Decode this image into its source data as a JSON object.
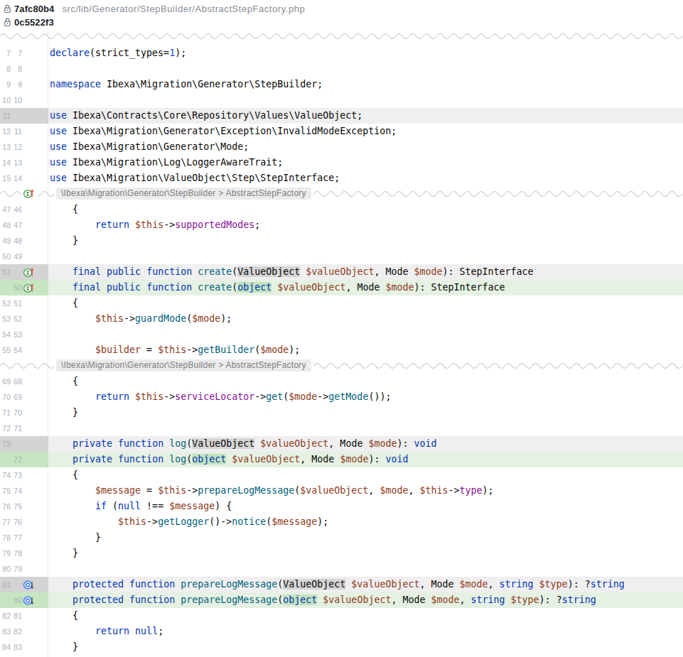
{
  "header": {
    "old_commit": "7afc80b4",
    "new_commit": "0c5522f3",
    "file_path": "src/lib/Generator/StepBuilder/AbstractStepFactory.php"
  },
  "colors": {
    "keyword": "#0033b3",
    "function": "#00627a",
    "variable": "#8d3b20",
    "field": "#871094",
    "number": "#1750eb",
    "plain_text": "#080808",
    "deleted_row_bg": "#efefef",
    "deleted_gutter_bg": "#d3d3d3",
    "deleted_word_bg": "#d5d5d5",
    "inserted_row_bg": "#e5f1e2",
    "inserted_gutter_bg": "#c5e6c0",
    "inserted_word_bg": "#c3e4be",
    "line_number": "#a9b0ba"
  },
  "icons": {
    "impl": "implements-method-icon",
    "ovr": "overridden-method-icon",
    "lock": "lock-icon"
  },
  "rows": [
    {
      "t": "wave"
    },
    {
      "t": "line",
      "k": "ctx",
      "o": "7",
      "n": "7",
      "icon": null,
      "seg": [
        [
          "kw",
          "declare"
        ],
        [
          "pl",
          "(strict_types="
        ],
        [
          "nm",
          "1"
        ],
        [
          "pl",
          ");"
        ]
      ]
    },
    {
      "t": "line",
      "k": "ctx",
      "o": "8",
      "n": "8",
      "icon": null,
      "seg": []
    },
    {
      "t": "line",
      "k": "ctx",
      "o": "9",
      "n": "9",
      "icon": null,
      "seg": [
        [
          "kw",
          "namespace"
        ],
        [
          "pl",
          " Ibexa\\Migration\\Generator\\StepBuilder;"
        ]
      ]
    },
    {
      "t": "line",
      "k": "ctx",
      "o": "10",
      "n": "10",
      "icon": null,
      "seg": []
    },
    {
      "t": "line",
      "k": "del",
      "o": "11",
      "n": null,
      "icon": null,
      "seg": [
        [
          "kw",
          "use"
        ],
        [
          "pl",
          " Ibexa\\Contracts\\Core\\Repository\\Values\\ValueObject;"
        ]
      ]
    },
    {
      "t": "line",
      "k": "ctx",
      "o": "12",
      "n": "11",
      "icon": null,
      "seg": [
        [
          "kw",
          "use"
        ],
        [
          "pl",
          " Ibexa\\Migration\\Generator\\Exception\\InvalidModeException;"
        ]
      ]
    },
    {
      "t": "line",
      "k": "ctx",
      "o": "13",
      "n": "12",
      "icon": null,
      "seg": [
        [
          "kw",
          "use"
        ],
        [
          "pl",
          " Ibexa\\Migration\\Generator\\Mode;"
        ]
      ]
    },
    {
      "t": "line",
      "k": "ctx",
      "o": "14",
      "n": "13",
      "icon": null,
      "seg": [
        [
          "kw",
          "use"
        ],
        [
          "pl",
          " Ibexa\\Migration\\Log\\LoggerAwareTrait;"
        ]
      ]
    },
    {
      "t": "line",
      "k": "ctx",
      "o": "15",
      "n": "14",
      "icon": null,
      "seg": [
        [
          "kw",
          "use"
        ],
        [
          "pl",
          " Ibexa\\Migration\\ValueObject\\Step\\StepInterface;"
        ]
      ]
    },
    {
      "t": "sep",
      "icon": "impl",
      "label": "\\Ibexa\\Migration\\Generator\\StepBuilder > AbstractStepFactory"
    },
    {
      "t": "line",
      "k": "ctx",
      "o": "47",
      "n": "46",
      "icon": null,
      "seg": [
        [
          "pl",
          "    {"
        ]
      ]
    },
    {
      "t": "line",
      "k": "ctx",
      "o": "48",
      "n": "47",
      "icon": null,
      "seg": [
        [
          "pl",
          "        "
        ],
        [
          "kw",
          "return"
        ],
        [
          "pl",
          " "
        ],
        [
          "vr",
          "$this"
        ],
        [
          "pl",
          "->"
        ],
        [
          "fd",
          "supportedModes"
        ],
        [
          "pl",
          ";"
        ]
      ]
    },
    {
      "t": "line",
      "k": "ctx",
      "o": "49",
      "n": "48",
      "icon": null,
      "seg": [
        [
          "pl",
          "    }"
        ]
      ]
    },
    {
      "t": "line",
      "k": "ctx",
      "o": "50",
      "n": "49",
      "icon": null,
      "seg": []
    },
    {
      "t": "line",
      "k": "del",
      "o": "51",
      "n": null,
      "icon": "impl",
      "seg": [
        [
          "pl",
          "    "
        ],
        [
          "kw",
          "final"
        ],
        [
          "pl",
          " "
        ],
        [
          "kw",
          "public"
        ],
        [
          "pl",
          " "
        ],
        [
          "kw",
          "function"
        ],
        [
          "pl",
          " "
        ],
        [
          "fn",
          "create"
        ],
        [
          "pl",
          "("
        ],
        [
          "pl",
          "ValueObject",
          1
        ],
        [
          "pl",
          " "
        ],
        [
          "vr",
          "$valueObject"
        ],
        [
          "pl",
          ", Mode "
        ],
        [
          "vr",
          "$mode"
        ],
        [
          "pl",
          "): StepInterface"
        ]
      ]
    },
    {
      "t": "line",
      "k": "ins",
      "o": null,
      "n": "50",
      "icon": "impl",
      "seg": [
        [
          "pl",
          "    "
        ],
        [
          "kw",
          "final"
        ],
        [
          "pl",
          " "
        ],
        [
          "kw",
          "public"
        ],
        [
          "pl",
          " "
        ],
        [
          "kw",
          "function"
        ],
        [
          "pl",
          " "
        ],
        [
          "fn",
          "create"
        ],
        [
          "pl",
          "("
        ],
        [
          "kw",
          "object",
          1
        ],
        [
          "pl",
          " "
        ],
        [
          "vr",
          "$valueObject"
        ],
        [
          "pl",
          ", Mode "
        ],
        [
          "vr",
          "$mode"
        ],
        [
          "pl",
          "): StepInterface"
        ]
      ]
    },
    {
      "t": "line",
      "k": "ctx",
      "o": "52",
      "n": "51",
      "icon": null,
      "seg": [
        [
          "pl",
          "    {"
        ]
      ]
    },
    {
      "t": "line",
      "k": "ctx",
      "o": "53",
      "n": "52",
      "icon": null,
      "seg": [
        [
          "pl",
          "        "
        ],
        [
          "vr",
          "$this"
        ],
        [
          "pl",
          "->"
        ],
        [
          "fn",
          "guardMode"
        ],
        [
          "pl",
          "("
        ],
        [
          "vr",
          "$mode"
        ],
        [
          "pl",
          ");"
        ]
      ]
    },
    {
      "t": "line",
      "k": "ctx",
      "o": "54",
      "n": "53",
      "icon": null,
      "seg": []
    },
    {
      "t": "line",
      "k": "ctx",
      "o": "55",
      "n": "54",
      "icon": null,
      "seg": [
        [
          "pl",
          "        "
        ],
        [
          "vr",
          "$builder"
        ],
        [
          "pl",
          " = "
        ],
        [
          "vr",
          "$this"
        ],
        [
          "pl",
          "->"
        ],
        [
          "fn",
          "getBuilder"
        ],
        [
          "pl",
          "("
        ],
        [
          "vr",
          "$mode"
        ],
        [
          "pl",
          ");"
        ]
      ]
    },
    {
      "t": "sep",
      "icon": null,
      "label": "\\Ibexa\\Migration\\Generator\\StepBuilder > AbstractStepFactory"
    },
    {
      "t": "line",
      "k": "ctx",
      "o": "69",
      "n": "68",
      "icon": null,
      "seg": [
        [
          "pl",
          "    {"
        ]
      ]
    },
    {
      "t": "line",
      "k": "ctx",
      "o": "70",
      "n": "69",
      "icon": null,
      "seg": [
        [
          "pl",
          "        "
        ],
        [
          "kw",
          "return"
        ],
        [
          "pl",
          " "
        ],
        [
          "vr",
          "$this"
        ],
        [
          "pl",
          "->"
        ],
        [
          "fd",
          "serviceLocator"
        ],
        [
          "pl",
          "->"
        ],
        [
          "fn",
          "get"
        ],
        [
          "pl",
          "("
        ],
        [
          "vr",
          "$mode"
        ],
        [
          "pl",
          "->"
        ],
        [
          "fn",
          "getMode"
        ],
        [
          "pl",
          "());"
        ]
      ]
    },
    {
      "t": "line",
      "k": "ctx",
      "o": "71",
      "n": "70",
      "icon": null,
      "seg": [
        [
          "pl",
          "    }"
        ]
      ]
    },
    {
      "t": "line",
      "k": "ctx",
      "o": "72",
      "n": "71",
      "icon": null,
      "seg": []
    },
    {
      "t": "line",
      "k": "del",
      "o": "73",
      "n": null,
      "icon": null,
      "seg": [
        [
          "pl",
          "    "
        ],
        [
          "kw",
          "private"
        ],
        [
          "pl",
          " "
        ],
        [
          "kw",
          "function"
        ],
        [
          "pl",
          " "
        ],
        [
          "fn",
          "log"
        ],
        [
          "pl",
          "("
        ],
        [
          "pl",
          "ValueObject",
          1
        ],
        [
          "pl",
          " "
        ],
        [
          "vr",
          "$valueObject"
        ],
        [
          "pl",
          ", Mode "
        ],
        [
          "vr",
          "$mode"
        ],
        [
          "pl",
          "): "
        ],
        [
          "kw",
          "void"
        ]
      ]
    },
    {
      "t": "line",
      "k": "ins",
      "o": null,
      "n": "72",
      "icon": null,
      "seg": [
        [
          "pl",
          "    "
        ],
        [
          "kw",
          "private"
        ],
        [
          "pl",
          " "
        ],
        [
          "kw",
          "function"
        ],
        [
          "pl",
          " "
        ],
        [
          "fn",
          "log"
        ],
        [
          "pl",
          "("
        ],
        [
          "kw",
          "object",
          1
        ],
        [
          "pl",
          " "
        ],
        [
          "vr",
          "$valueObject"
        ],
        [
          "pl",
          ", Mode "
        ],
        [
          "vr",
          "$mode"
        ],
        [
          "pl",
          "): "
        ],
        [
          "kw",
          "void"
        ]
      ]
    },
    {
      "t": "line",
      "k": "ctx",
      "o": "74",
      "n": "73",
      "icon": null,
      "seg": [
        [
          "pl",
          "    {"
        ]
      ]
    },
    {
      "t": "line",
      "k": "ctx",
      "o": "75",
      "n": "74",
      "icon": null,
      "seg": [
        [
          "pl",
          "        "
        ],
        [
          "vr",
          "$message"
        ],
        [
          "pl",
          " = "
        ],
        [
          "vr",
          "$this"
        ],
        [
          "pl",
          "->"
        ],
        [
          "fn",
          "prepareLogMessage"
        ],
        [
          "pl",
          "("
        ],
        [
          "vr",
          "$valueObject"
        ],
        [
          "pl",
          ", "
        ],
        [
          "vr",
          "$mode"
        ],
        [
          "pl",
          ", "
        ],
        [
          "vr",
          "$this"
        ],
        [
          "pl",
          "->"
        ],
        [
          "fd",
          "type"
        ],
        [
          "pl",
          ");"
        ]
      ]
    },
    {
      "t": "line",
      "k": "ctx",
      "o": "76",
      "n": "75",
      "icon": null,
      "seg": [
        [
          "pl",
          "        "
        ],
        [
          "kw",
          "if"
        ],
        [
          "pl",
          " ("
        ],
        [
          "kw",
          "null"
        ],
        [
          "pl",
          " !== "
        ],
        [
          "vr",
          "$message"
        ],
        [
          "pl",
          ") {"
        ]
      ]
    },
    {
      "t": "line",
      "k": "ctx",
      "o": "77",
      "n": "76",
      "icon": null,
      "seg": [
        [
          "pl",
          "            "
        ],
        [
          "vr",
          "$this"
        ],
        [
          "pl",
          "->"
        ],
        [
          "fn",
          "getLogger"
        ],
        [
          "pl",
          "()->"
        ],
        [
          "fn",
          "notice"
        ],
        [
          "pl",
          "("
        ],
        [
          "vr",
          "$message"
        ],
        [
          "pl",
          ");"
        ]
      ]
    },
    {
      "t": "line",
      "k": "ctx",
      "o": "78",
      "n": "77",
      "icon": null,
      "seg": [
        [
          "pl",
          "        }"
        ]
      ]
    },
    {
      "t": "line",
      "k": "ctx",
      "o": "79",
      "n": "78",
      "icon": null,
      "seg": [
        [
          "pl",
          "    }"
        ]
      ]
    },
    {
      "t": "line",
      "k": "ctx",
      "o": "80",
      "n": "79",
      "icon": null,
      "seg": []
    },
    {
      "t": "line",
      "k": "del",
      "o": "81",
      "n": null,
      "icon": "ovr",
      "seg": [
        [
          "pl",
          "    "
        ],
        [
          "kw",
          "protected"
        ],
        [
          "pl",
          " "
        ],
        [
          "kw",
          "function"
        ],
        [
          "pl",
          " "
        ],
        [
          "fn",
          "prepareLogMessage"
        ],
        [
          "pl",
          "("
        ],
        [
          "pl",
          "ValueObject",
          1
        ],
        [
          "pl",
          " "
        ],
        [
          "vr",
          "$valueObject"
        ],
        [
          "pl",
          ", Mode "
        ],
        [
          "vr",
          "$mode"
        ],
        [
          "pl",
          ", "
        ],
        [
          "kw",
          "string"
        ],
        [
          "pl",
          " "
        ],
        [
          "vr",
          "$type"
        ],
        [
          "pl",
          "): ?"
        ],
        [
          "kw",
          "string"
        ]
      ]
    },
    {
      "t": "line",
      "k": "ins",
      "o": null,
      "n": "80",
      "icon": "ovr",
      "seg": [
        [
          "pl",
          "    "
        ],
        [
          "kw",
          "protected"
        ],
        [
          "pl",
          " "
        ],
        [
          "kw",
          "function"
        ],
        [
          "pl",
          " "
        ],
        [
          "fn",
          "prepareLogMessage"
        ],
        [
          "pl",
          "("
        ],
        [
          "kw",
          "object",
          1
        ],
        [
          "pl",
          " "
        ],
        [
          "vr",
          "$valueObject"
        ],
        [
          "pl",
          ", Mode "
        ],
        [
          "vr",
          "$mode"
        ],
        [
          "pl",
          ", "
        ],
        [
          "kw",
          "string"
        ],
        [
          "pl",
          " "
        ],
        [
          "vr",
          "$type"
        ],
        [
          "pl",
          "): ?"
        ],
        [
          "kw",
          "string"
        ]
      ]
    },
    {
      "t": "line",
      "k": "ctx",
      "o": "82",
      "n": "81",
      "icon": null,
      "seg": [
        [
          "pl",
          "    {"
        ]
      ]
    },
    {
      "t": "line",
      "k": "ctx",
      "o": "83",
      "n": "82",
      "icon": null,
      "seg": [
        [
          "pl",
          "        "
        ],
        [
          "kw",
          "return"
        ],
        [
          "pl",
          " "
        ],
        [
          "kw",
          "null"
        ],
        [
          "pl",
          ";"
        ]
      ]
    },
    {
      "t": "line",
      "k": "ctx",
      "o": "84",
      "n": "83",
      "icon": null,
      "seg": [
        [
          "pl",
          "    }"
        ]
      ]
    }
  ]
}
